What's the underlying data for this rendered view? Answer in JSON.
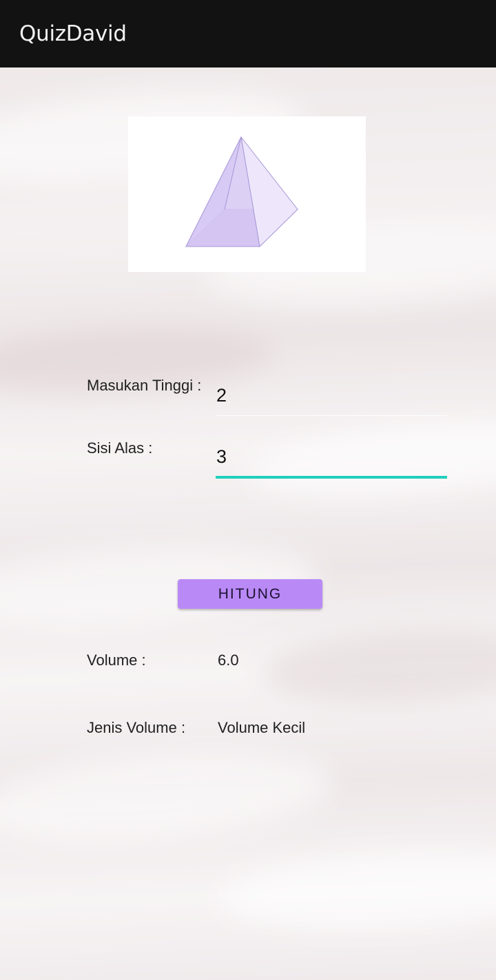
{
  "app_bar": {
    "title": "QuizDavid",
    "background_color": "#121212"
  },
  "figure": {
    "icon": "square-pyramid-icon",
    "fill_color": "#c9b6f0"
  },
  "form": {
    "tinggi": {
      "label": "Masukan Tinggi :",
      "value": "2",
      "placeholder": ""
    },
    "sisi_alas": {
      "label": "Sisi Alas :",
      "value": "3",
      "placeholder": ""
    },
    "focused_underline_color": "#1fcfbd"
  },
  "button": {
    "label": "HITUNG",
    "color": "#b98af6"
  },
  "results": {
    "volume_label": "Volume :",
    "volume_value": "6.0",
    "jenis_label": "Jenis Volume :",
    "jenis_value": "Volume Kecil"
  }
}
